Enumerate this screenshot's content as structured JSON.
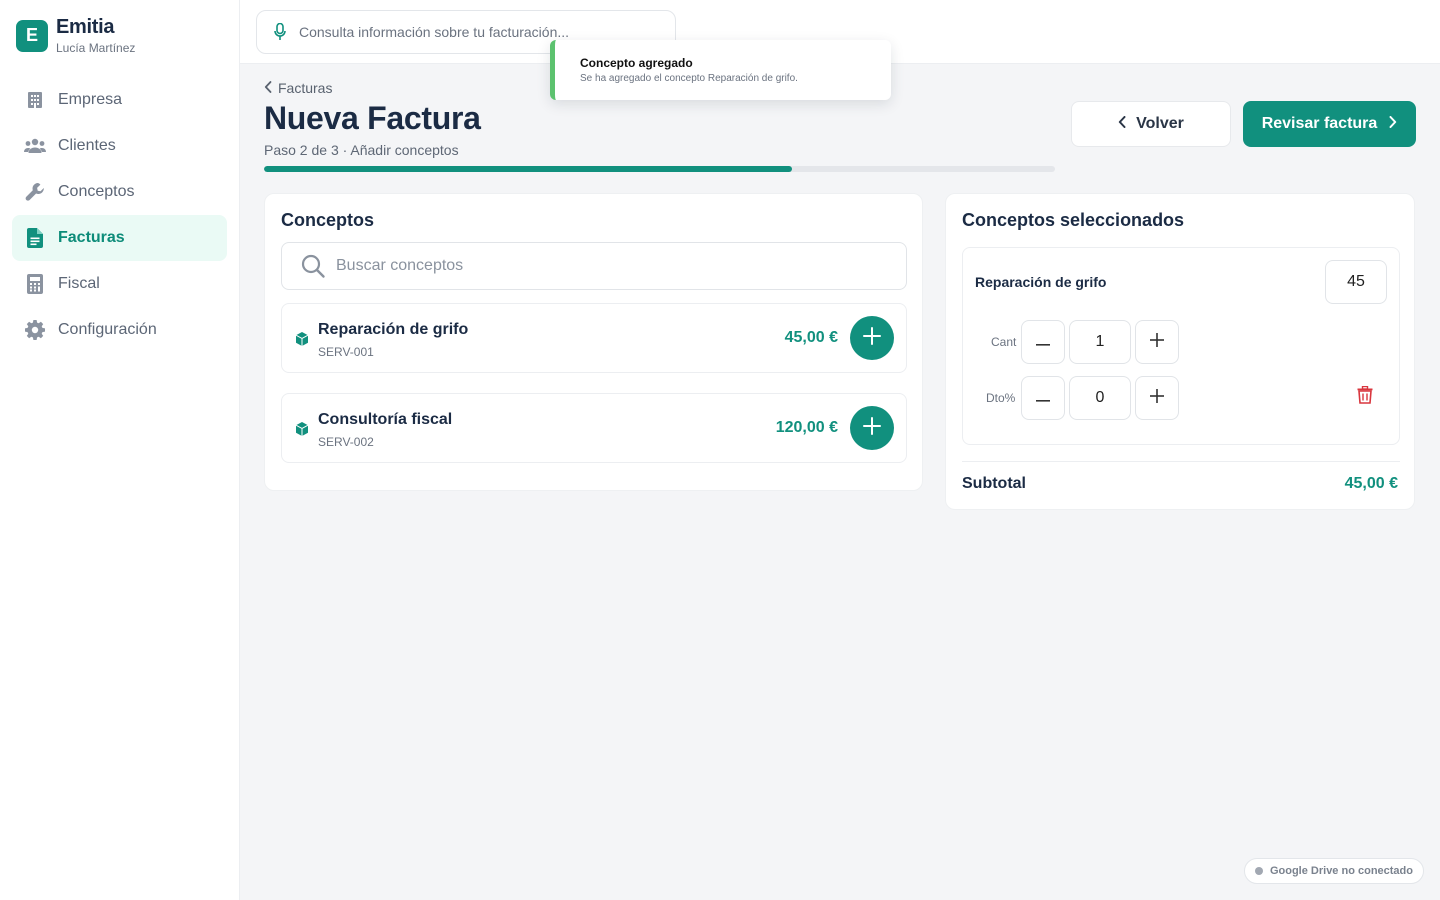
{
  "brand": {
    "logo_letter": "E",
    "name": "Emitia",
    "user": "Lucía Martínez"
  },
  "sidebar": {
    "items": [
      {
        "label": "Empresa",
        "icon": "building-icon",
        "active": false
      },
      {
        "label": "Clientes",
        "icon": "users-icon",
        "active": false
      },
      {
        "label": "Conceptos",
        "icon": "wrench-icon",
        "active": false
      },
      {
        "label": "Facturas",
        "icon": "document-icon",
        "active": true
      },
      {
        "label": "Fiscal",
        "icon": "calculator-icon",
        "active": false
      },
      {
        "label": "Configuración",
        "icon": "gear-icon",
        "active": false
      }
    ]
  },
  "topbar": {
    "ask_text": "Consulta información sobre tu facturación..."
  },
  "toast": {
    "title": "Concepto agregado",
    "body": "Se ha agregado el concepto Reparación de grifo."
  },
  "header": {
    "breadcrumb": "Facturas",
    "title": "Nueva Factura",
    "subtitle": "Paso 2 de 3 · Añadir conceptos",
    "progress": 0.667,
    "back_label": "Volver",
    "review_label": "Revisar factura"
  },
  "concepts": {
    "title": "Conceptos",
    "search_placeholder": "Buscar conceptos",
    "items": [
      {
        "name": "Reparación de grifo",
        "code": "SERV-001",
        "price": "45,00 €"
      },
      {
        "name": "Consultoría fiscal",
        "code": "SERV-002",
        "price": "120,00 €"
      }
    ]
  },
  "selected": {
    "title": "Conceptos seleccionados",
    "item": {
      "name": "Reparación de grifo",
      "price": "45",
      "qty_label": "Cant",
      "qty": "1",
      "disc_label": "Dto%",
      "disc": "0"
    },
    "subtotal_label": "Subtotal",
    "subtotal_value": "45,00 €"
  },
  "status": {
    "drive": "Google Drive no conectado"
  },
  "colors": {
    "accent": "#11907e",
    "toast_accent": "#5cc26f",
    "danger": "#d9363e"
  }
}
